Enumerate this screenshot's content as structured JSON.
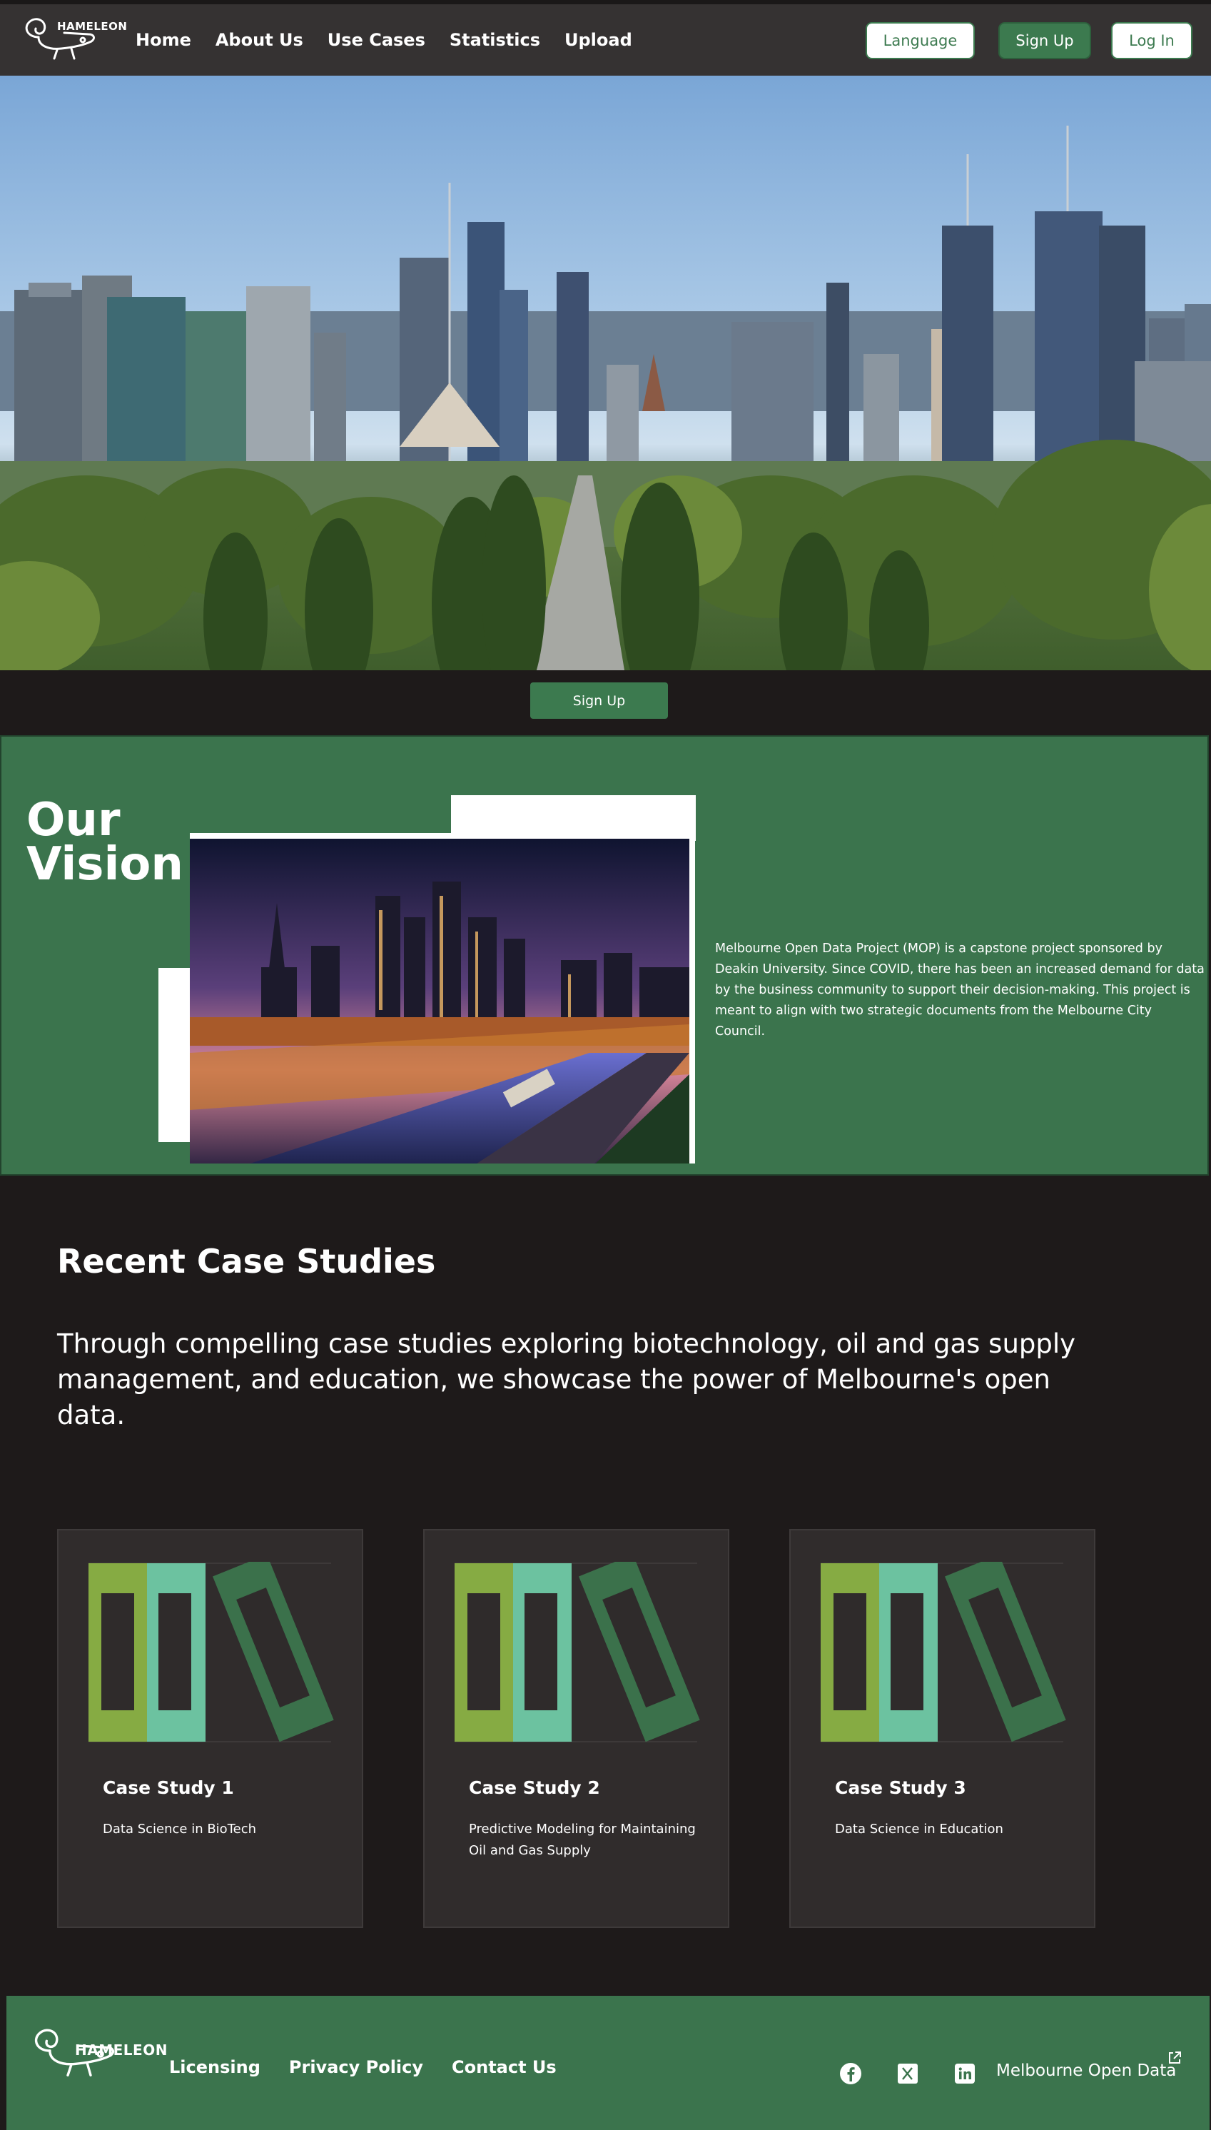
{
  "brand": {
    "logo_text": "HAMELEON"
  },
  "nav": {
    "links": [
      "Home",
      "About Us",
      "Use Cases",
      "Statistics",
      "Upload"
    ],
    "language_label": "Language",
    "signup_label": "Sign Up",
    "login_label": "Log In"
  },
  "hero": {
    "signup_label": "Sign Up"
  },
  "vision": {
    "title": "Our Vision",
    "text": "Melbourne Open Data Project (MOP) is a capstone project sponsored by Deakin University. Since COVID, there has been an increased demand for data by the business community to support their decision-making. This project is meant to align with two strategic documents from the Melbourne City Council."
  },
  "case_studies": {
    "heading": "Recent Case Studies",
    "subheading": "Through compelling case studies exploring biotechnology, oil and gas supply management, and education, we showcase the power of Melbourne's open data.",
    "cards": [
      {
        "title": "Case Study 1",
        "description": "Data Science in BioTech"
      },
      {
        "title": "Case Study 2",
        "description": "Predictive Modeling for Maintaining Oil and Gas Supply"
      },
      {
        "title": "Case Study 3",
        "description": "Data Science in Education"
      }
    ]
  },
  "footer": {
    "links": [
      "Licensing",
      "Privacy Policy",
      "Contact Us"
    ],
    "social_icons": [
      "facebook-icon",
      "x-icon",
      "linkedin-icon"
    ],
    "external_link_label": "Melbourne Open Data"
  },
  "colors": {
    "accent_green": "#3c7a4f",
    "nav_bg": "#353232",
    "page_bg": "#1e1a1a",
    "card_bg": "#302c2c"
  }
}
